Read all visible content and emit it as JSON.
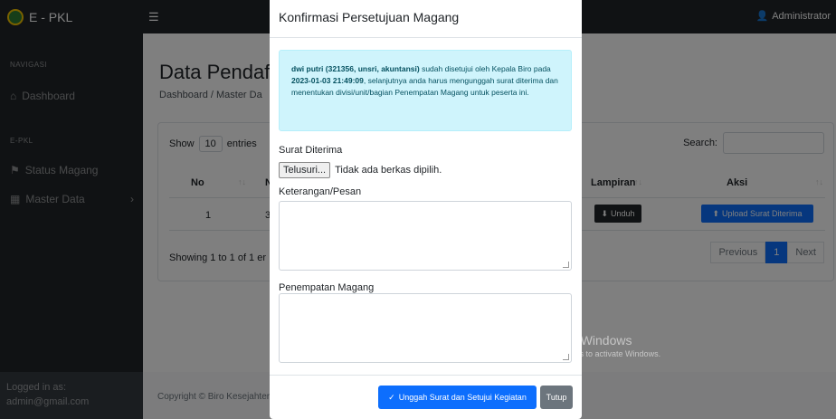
{
  "app": {
    "brand": "E - PKL",
    "user": "Administrator"
  },
  "sidebar": {
    "heading_nav": "NAVIGASI",
    "dashboard": "Dashboard",
    "heading_pkl": "E-PKL",
    "status": "Status Magang",
    "master": "Master Data",
    "logged_label": "Logged in as:",
    "logged_user": "admin@gmail.com"
  },
  "main": {
    "title": "Data Pendafta",
    "breadcrumb": "Dashboard / Master Da",
    "show": "Show",
    "entries_value": "10",
    "entries": "entries",
    "search_label": "Search:",
    "columns": {
      "no": "No",
      "n": "N",
      "lampiran": "Lampiran",
      "aksi": "Aksi"
    },
    "row": {
      "no": "1",
      "partial": "3",
      "unduh": "Unduh",
      "upload": "Upload Surat Diterima"
    },
    "showing": "Showing 1 to 1 of 1 er",
    "pager": {
      "prev": "Previous",
      "page": "1",
      "next": "Next"
    },
    "copyright": "Copyright © Biro Kesejahter"
  },
  "watermark": {
    "line1": "Activate Windows",
    "line2": "Go to Settings to activate Windows."
  },
  "modal": {
    "title": "Konfirmasi Persetujuan Magang",
    "alert": {
      "who": "dwi putri (321356, unsri, akuntansi)",
      "t1": " sudah disetujui oleh Kepala Biro pada ",
      "when": "2023-01-03 21:49:09",
      "t2": ", selanjutnya anda harus mengunggah surat diterima dan menentukan divisi/unit/bagian Penempatan Magang untuk peserta ini."
    },
    "surat_label": "Surat Diterima",
    "browse": "Telusuri...",
    "no_file": "Tidak ada berkas dipilih.",
    "keterangan_label": "Keterangan/Pesan",
    "penempatan_label": "Penempatan Magang",
    "submit": "Unggah Surat dan Setujui Kegiatan",
    "close": "Tutup"
  },
  "colors": {
    "primary": "#0d6efd",
    "secondary": "#6c757d",
    "dark": "#212529",
    "info_bg": "#cff4fc"
  }
}
